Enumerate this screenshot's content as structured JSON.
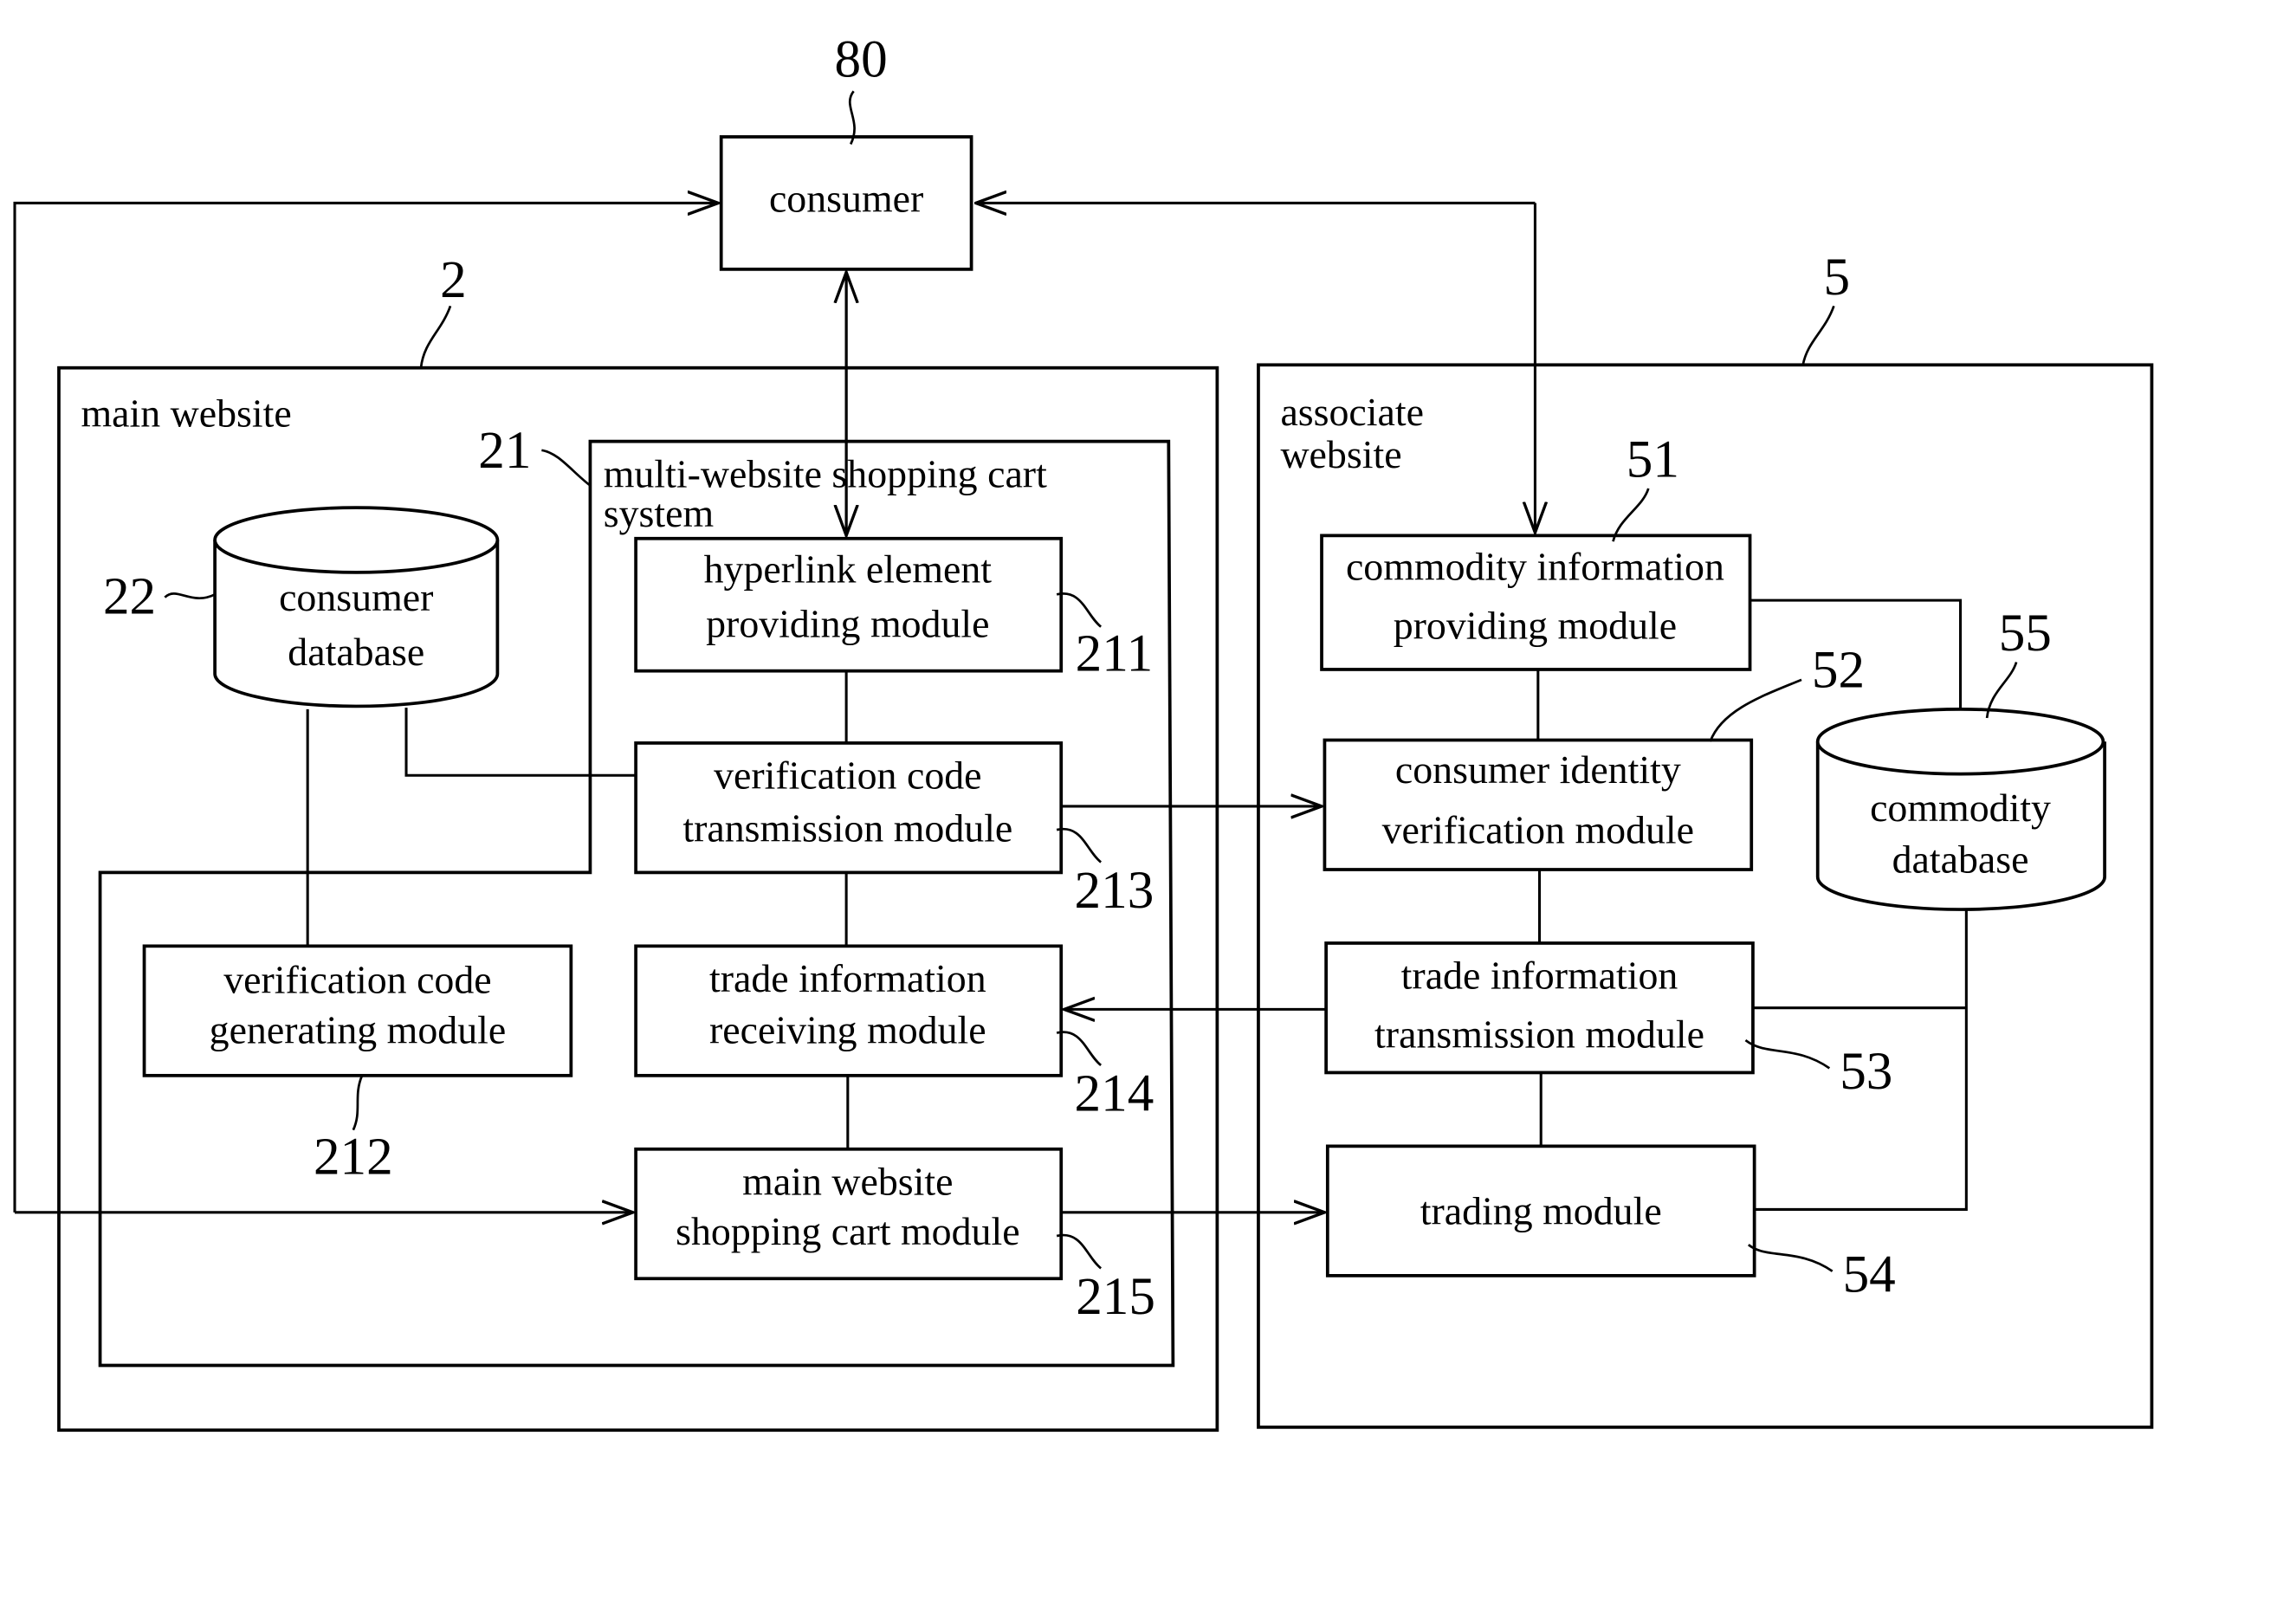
{
  "figure": {
    "consumer": {
      "label": "consumer",
      "ref": "80"
    },
    "main_website": {
      "label": "main website",
      "ref": "2",
      "shopping_cart_system": {
        "label_line1": "multi-website shopping cart",
        "label_line2": "system",
        "ref": "21"
      },
      "consumer_database": {
        "line1": "consumer",
        "line2": "database",
        "ref": "22"
      },
      "modules": [
        {
          "id": "211",
          "line1": "hyperlink element",
          "line2": "providing module",
          "ref": "211"
        },
        {
          "id": "212",
          "line1": "verification code",
          "line2": "generating module",
          "ref": "212"
        },
        {
          "id": "213",
          "line1": "verification code",
          "line2": "transmission module",
          "ref": "213"
        },
        {
          "id": "214",
          "line1": "trade information",
          "line2": "receiving module",
          "ref": "214"
        },
        {
          "id": "215",
          "line1": "main website",
          "line2": "shopping cart module",
          "ref": "215"
        }
      ]
    },
    "associate_website": {
      "label_line1": "associate",
      "label_line2": "website",
      "ref": "5",
      "commodity_database": {
        "line1": "commodity",
        "line2": "database",
        "ref": "55"
      },
      "modules": [
        {
          "id": "51",
          "line1": "commodity information",
          "line2": "providing module",
          "ref": "51"
        },
        {
          "id": "52",
          "line1": "consumer identity",
          "line2": "verification module",
          "ref": "52"
        },
        {
          "id": "53",
          "line1": "trade information",
          "line2": "transmission module",
          "ref": "53"
        },
        {
          "id": "54",
          "line1": "trading module",
          "ref": "54"
        }
      ]
    }
  }
}
